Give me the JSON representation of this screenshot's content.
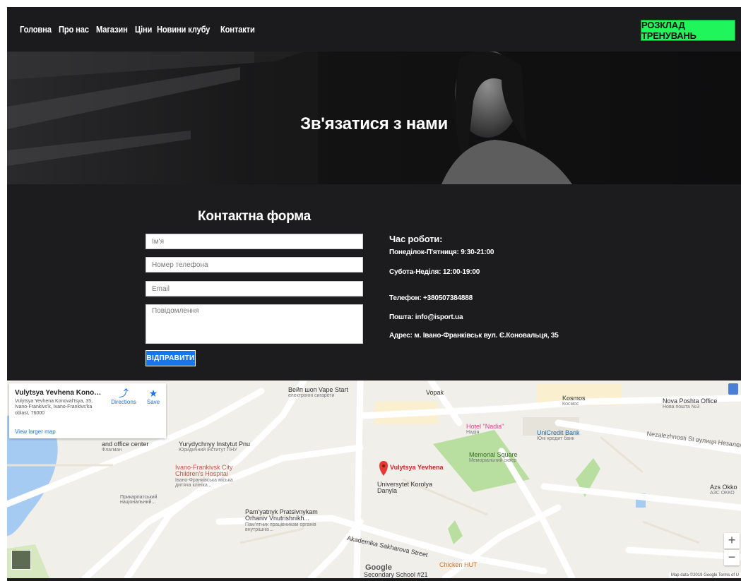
{
  "nav": {
    "links": [
      "Головна",
      "Про нас",
      "Магазин",
      "Ціни",
      "Новини клубу",
      "Контакти"
    ],
    "cta": "РОЗКЛАД ТРЕНУВАНЬ"
  },
  "hero": {
    "title": "Зв'язатися з нами"
  },
  "form": {
    "title": "Контактна форма",
    "name_placeholder": "Ім'я",
    "phone_placeholder": "Номер телефона",
    "email_placeholder": "Email",
    "message_placeholder": "Повідомлення",
    "submit": "ВІДПРАВИТИ"
  },
  "info": {
    "heading": "Час роботи:",
    "weekdays": "Понеділок-П'ятниця: 9:30-21:00",
    "weekend": "Субота-Неділя: 12:00-19:00",
    "phone": "Телефон: +380507384888",
    "email": "Пошта: info@isport.ua",
    "address": "Адрес: м. Івано-Франківськ вул. Є.Коновальця, 35"
  },
  "map": {
    "card": {
      "title": "Vulytsya Yevhena Konoval'tsy...",
      "address": "Vulytsya Yevhena Konoval'tsya, 35, Ivano-Frankivs'k, Ivano-Frankivs'ka oblast, 76000",
      "directions": "Directions",
      "save": "Save",
      "larger_map": "View larger map"
    },
    "labels": {
      "vape": "Вейп шоп Vape Start",
      "vape_sub": "електронні сигарети",
      "vopak": "Vopak",
      "kosmos": "Kosmos",
      "kosmos_sub": "Космос",
      "nova": "Nova Poshta Office",
      "nova_sub": "Нова пошта №3",
      "hotel": "Hotel \"Nadia\"",
      "hotel_sub": "Надія",
      "unicredit": "UniCredit Bank",
      "unicredit_sub": "Юні кредит банк",
      "memorial": "Memorial Square",
      "memorial_sub": "Меморіальний сквер",
      "yurydych": "Yurydychnyy Instytut Pnu",
      "yurydych_sub": "Юридичний інститут ПНУ",
      "office_center": "and office center",
      "office_sub": "Флагман",
      "hospital": "Ivano-Frankivsk City Children's Hospital",
      "hospital_sub": "Івано-Франківська міська дитяча клініка...",
      "pin": "Vulytsya Yevhena",
      "univ": "Universytet Korolya Danyla",
      "carpathian": "Прикарпатський національний...",
      "pamyat": "Pam'yatnyk Pratsivnykam Orhaniv Vnutrishnikh...",
      "pamyat_sub": "Пам'ятник працівникам органів внутрішніх...",
      "sakharova": "Akademika Sakharova Street",
      "chicken": "Chicken HUT",
      "school": "Secondary School #21",
      "nezalezhnosti": "Nezalezhnosti St вулиця Незалежно",
      "azs": "Azs Okko",
      "azs_sub": "АЗС ОККО",
      "google": "Google",
      "attribution": "Map data ©2019 Google   Terms of U"
    }
  }
}
